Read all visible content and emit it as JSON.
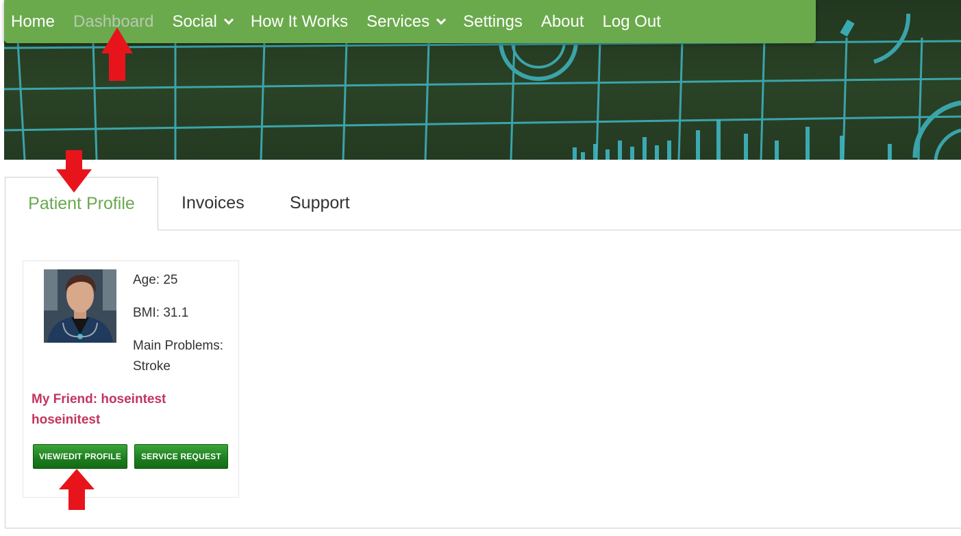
{
  "navbar": {
    "items": [
      {
        "label": "Home"
      },
      {
        "label": "Dashboard"
      },
      {
        "label": "Social"
      },
      {
        "label": "How It Works"
      },
      {
        "label": "Services"
      },
      {
        "label": "Settings"
      },
      {
        "label": "About"
      },
      {
        "label": "Log Out"
      }
    ]
  },
  "tabs": [
    {
      "label": "Patient Profile",
      "active": true
    },
    {
      "label": "Invoices"
    },
    {
      "label": "Support"
    }
  ],
  "profile": {
    "age": "Age: 25",
    "bmi": "BMI: 31.1",
    "main_problems_label": "Main Problems:",
    "main_problems_value": "Stroke",
    "friend": "My Friend: hoseintest hoseinitest",
    "view_edit_label": "VIEW/EDIT PROFILE",
    "service_request_label": "SERVICE REQUEST"
  },
  "colors": {
    "nav_bg": "#6aaa4c",
    "active_tab": "#6aa84f",
    "friend_text": "#c2345f",
    "button_green": "#1e7f1f",
    "annotation_arrow": "#e8141c"
  }
}
